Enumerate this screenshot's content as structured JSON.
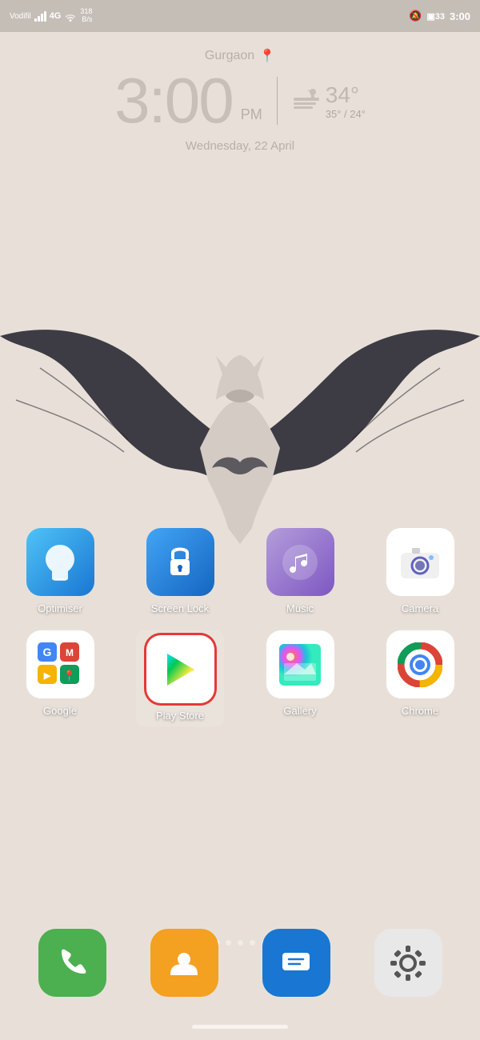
{
  "statusBar": {
    "carrier": "Vodafil",
    "network": "4G",
    "networkSpeed": "318\nB/s",
    "time": "3:00",
    "batteryLevel": "33"
  },
  "clock": {
    "location": "Gurgaon",
    "time": "3:00",
    "ampm": "PM",
    "temperature": "34°",
    "range": "35° / 24°",
    "date": "Wednesday, 22 April"
  },
  "pageDots": {
    "count": 5,
    "active": 1
  },
  "apps": {
    "row1": [
      {
        "id": "optimiser",
        "label": "Optimiser"
      },
      {
        "id": "screenlock",
        "label": "Screen Lock"
      },
      {
        "id": "music",
        "label": "Music"
      },
      {
        "id": "camera",
        "label": "Camera"
      }
    ],
    "row2": [
      {
        "id": "google",
        "label": "Google"
      },
      {
        "id": "playstore",
        "label": "Play Store",
        "selected": true
      },
      {
        "id": "gallery",
        "label": "Gallery"
      },
      {
        "id": "chrome",
        "label": "Chrome"
      }
    ]
  },
  "dock": [
    {
      "id": "phone",
      "label": ""
    },
    {
      "id": "contacts",
      "label": ""
    },
    {
      "id": "messages",
      "label": ""
    },
    {
      "id": "settings",
      "label": ""
    }
  ]
}
